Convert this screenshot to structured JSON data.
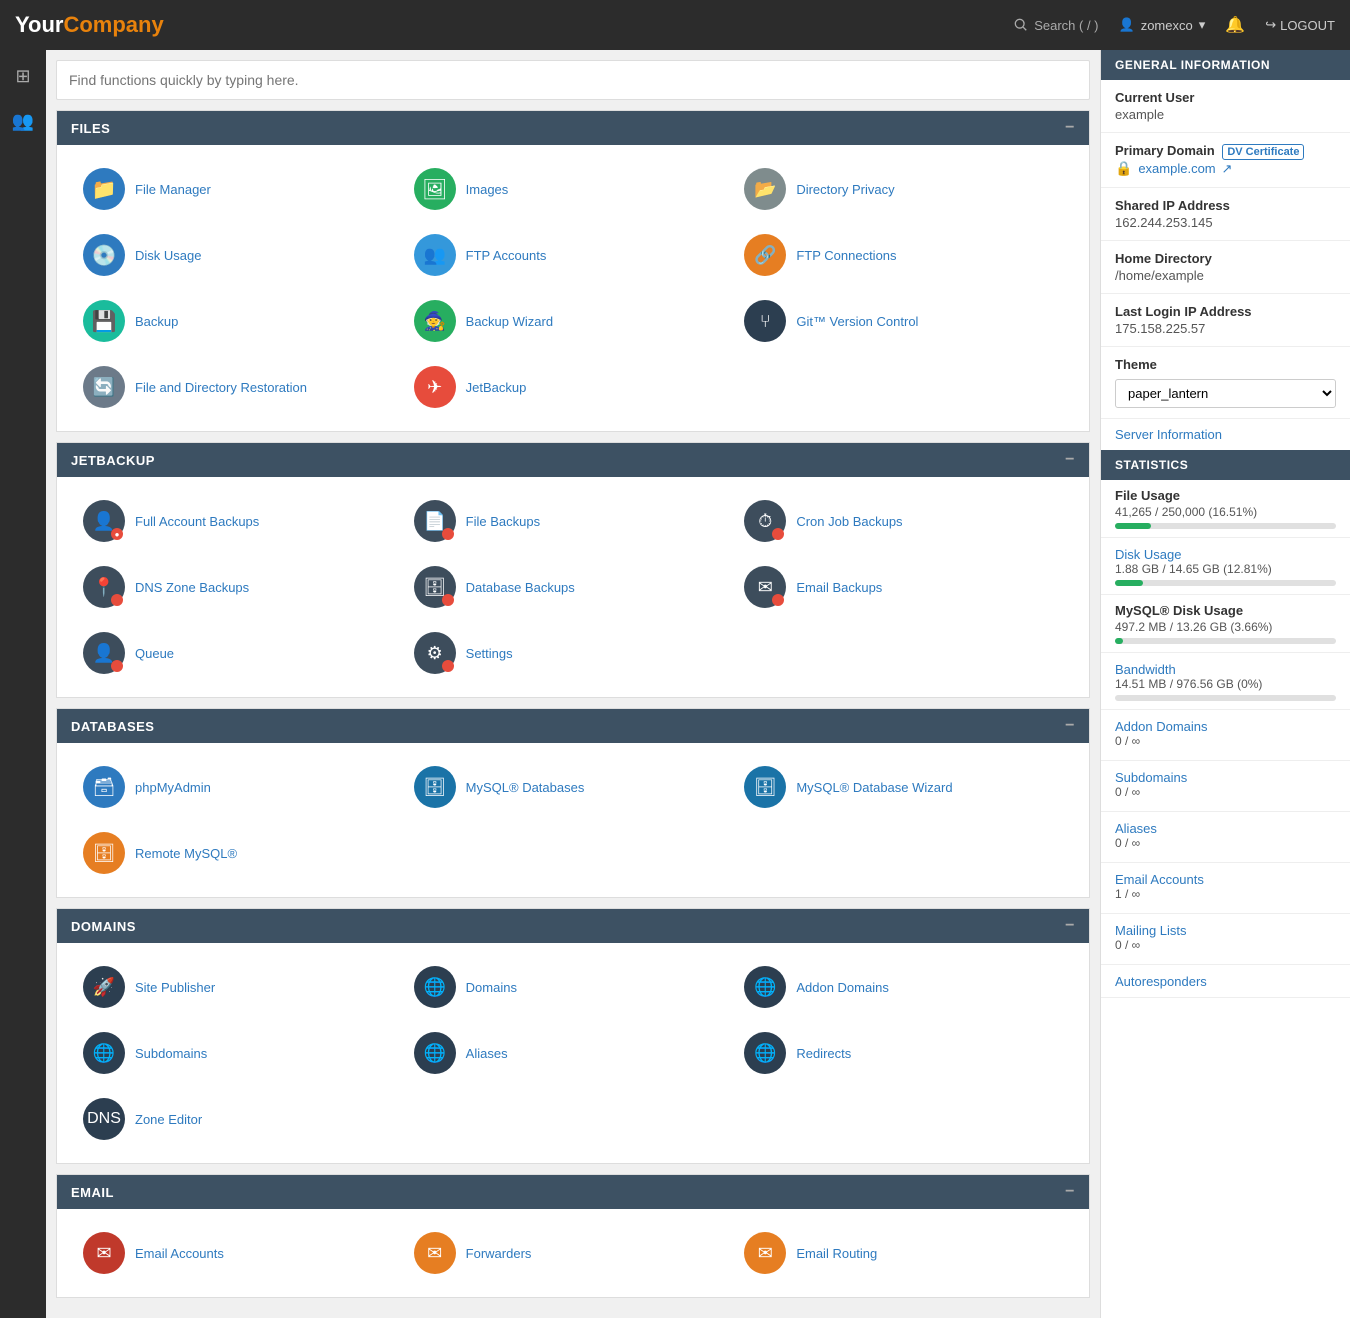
{
  "brand": {
    "your": "Your",
    "company": "Company"
  },
  "topnav": {
    "search_label": "Search ( / )",
    "user": "zomexco",
    "logout_label": "LOGOUT"
  },
  "quick_search": {
    "placeholder": "Find functions quickly by typing here."
  },
  "sections": {
    "files": {
      "title": "FILES",
      "items": [
        {
          "label": "File Manager",
          "icon_bg": "#2e7abf",
          "icon": "📁"
        },
        {
          "label": "Images",
          "icon_bg": "#27ae60",
          "icon": "🖼"
        },
        {
          "label": "Directory Privacy",
          "icon_bg": "#7f8c8d",
          "icon": "📂"
        },
        {
          "label": "Disk Usage",
          "icon_bg": "#2e7abf",
          "icon": "💿"
        },
        {
          "label": "FTP Accounts",
          "icon_bg": "#3498db",
          "icon": "👥"
        },
        {
          "label": "FTP Connections",
          "icon_bg": "#e67e22",
          "icon": "🔗"
        },
        {
          "label": "Backup",
          "icon_bg": "#1abc9c",
          "icon": "💾"
        },
        {
          "label": "Backup Wizard",
          "icon_bg": "#27ae60",
          "icon": "🧙"
        },
        {
          "label": "Git™ Version Control",
          "icon_bg": "#2c3e50",
          "icon": "⑂"
        },
        {
          "label": "File and Directory Restoration",
          "icon_bg": "#6c7a89",
          "icon": "🔄"
        },
        {
          "label": "JetBackup",
          "icon_bg": "#e74c3c",
          "icon": "✈"
        }
      ]
    },
    "jetbackup": {
      "title": "JETBACKUP",
      "items": [
        {
          "label": "Full Account Backups",
          "icon_bg": "#3d4d5c",
          "icon": "👤"
        },
        {
          "label": "File Backups",
          "icon_bg": "#3d4d5c",
          "icon": "📄"
        },
        {
          "label": "Cron Job Backups",
          "icon_bg": "#3d4d5c",
          "icon": "⏱"
        },
        {
          "label": "DNS Zone Backups",
          "icon_bg": "#3d4d5c",
          "icon": "📍"
        },
        {
          "label": "Database Backups",
          "icon_bg": "#3d4d5c",
          "icon": "🗄"
        },
        {
          "label": "Email Backups",
          "icon_bg": "#3d4d5c",
          "icon": "✉"
        },
        {
          "label": "Queue",
          "icon_bg": "#3d4d5c",
          "icon": "👤"
        },
        {
          "label": "Settings",
          "icon_bg": "#3d4d5c",
          "icon": "⚙"
        }
      ]
    },
    "databases": {
      "title": "DATABASES",
      "items": [
        {
          "label": "phpMyAdmin",
          "icon_bg": "#2e7abf",
          "icon": "🗃"
        },
        {
          "label": "MySQL® Databases",
          "icon_bg": "#1a73a7",
          "icon": "🗄"
        },
        {
          "label": "MySQL® Database Wizard",
          "icon_bg": "#1a73a7",
          "icon": "🗄"
        },
        {
          "label": "Remote MySQL®",
          "icon_bg": "#e67e22",
          "icon": "🗄"
        }
      ]
    },
    "domains": {
      "title": "DOMAINS",
      "items": [
        {
          "label": "Site Publisher",
          "icon_bg": "#2c3e50",
          "icon": "🚀"
        },
        {
          "label": "Domains",
          "icon_bg": "#2c3e50",
          "icon": "🌐"
        },
        {
          "label": "Addon Domains",
          "icon_bg": "#2c3e50",
          "icon": "🌐"
        },
        {
          "label": "Subdomains",
          "icon_bg": "#2c3e50",
          "icon": "🌐"
        },
        {
          "label": "Aliases",
          "icon_bg": "#2c3e50",
          "icon": "🌐"
        },
        {
          "label": "Redirects",
          "icon_bg": "#2c3e50",
          "icon": "🌐"
        },
        {
          "label": "Zone Editor",
          "icon_bg": "#2c3e50",
          "icon": "📋"
        }
      ]
    },
    "email": {
      "title": "EMAIL",
      "items": [
        {
          "label": "Email Accounts",
          "icon_bg": "#c0392b",
          "icon": "✉"
        },
        {
          "label": "Forwarders",
          "icon_bg": "#e67e22",
          "icon": "✉"
        },
        {
          "label": "Email Routing",
          "icon_bg": "#e67e22",
          "icon": "✉"
        }
      ]
    }
  },
  "general_info": {
    "title": "GENERAL INFORMATION",
    "current_user_label": "Current User",
    "current_user_value": "example",
    "primary_domain_label": "Primary Domain",
    "dv_cert_label": "DV Certificate",
    "domain_link": "example.com",
    "shared_ip_label": "Shared IP Address",
    "shared_ip_value": "162.244.253.145",
    "home_dir_label": "Home Directory",
    "home_dir_value": "/home/example",
    "last_login_label": "Last Login IP Address",
    "last_login_value": "175.158.225.57",
    "theme_label": "Theme",
    "theme_value": "paper_lantern",
    "server_info_label": "Server Information"
  },
  "statistics": {
    "title": "STATISTICS",
    "file_usage_label": "File Usage",
    "file_usage_value": "41,265 / 250,000  (16.51%)",
    "file_usage_pct": 16.51,
    "disk_usage_label": "Disk Usage",
    "disk_usage_value": "1.88 GB / 14.65 GB  (12.81%)",
    "disk_usage_pct": 12.81,
    "mysql_disk_label": "MySQL® Disk Usage",
    "mysql_disk_value": "497.2 MB / 13.26 GB  (3.66%)",
    "mysql_disk_pct": 3.66,
    "bandwidth_label": "Bandwidth",
    "bandwidth_value": "14.51 MB / 976.56 GB  (0%)",
    "bandwidth_pct": 0,
    "addon_domains_label": "Addon Domains",
    "addon_domains_value": "0 / ∞",
    "subdomains_label": "Subdomains",
    "subdomains_value": "0 / ∞",
    "aliases_label": "Aliases",
    "aliases_value": "0 / ∞",
    "email_accounts_label": "Email Accounts",
    "email_accounts_value": "1 / ∞",
    "mailing_lists_label": "Mailing Lists",
    "mailing_lists_value": "0 / ∞",
    "autoresponders_label": "Autoresponders"
  }
}
